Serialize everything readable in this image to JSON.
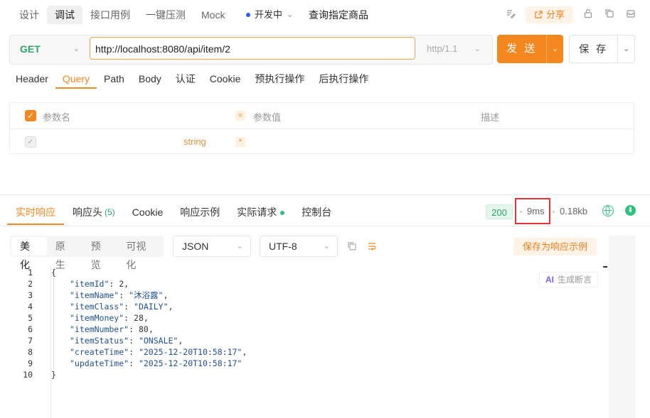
{
  "mode_tabs": [
    "设计",
    "调试",
    "接口用例",
    "一键压测",
    "Mock"
  ],
  "environment": "开发中",
  "api_title": "查询指定商品",
  "share_label": "分享",
  "request": {
    "method": "GET",
    "url": "http://localhost:8080/api/item/2",
    "http_version": "http/1.1",
    "send_label": "发 送",
    "save_label": "保 存"
  },
  "request_tabs": [
    "Header",
    "Query",
    "Path",
    "Body",
    "认证",
    "Cookie",
    "预执行操作",
    "后执行操作"
  ],
  "params": {
    "col_name": "参数名",
    "col_value": "参数值",
    "col_desc": "描述",
    "row_type": "string",
    "row_required": "*"
  },
  "response_tabs": {
    "realtime": "实时响应",
    "headers": "响应头",
    "headers_count": "(5)",
    "cookie": "Cookie",
    "example": "响应示例",
    "actual": "实际请求",
    "console": "控制台"
  },
  "status_code": "200",
  "time": "9ms",
  "size": "0.18kb",
  "format_tabs": [
    "美化",
    "原生",
    "预览",
    "可视化"
  ],
  "format_select": "JSON",
  "encoding_select": "UTF-8",
  "save_example_label": "保存为响应示例",
  "ai_badge": {
    "ai": "AI",
    "label": "生成断言"
  },
  "line_numbers": [
    "1",
    "2",
    "3",
    "4",
    "5",
    "6",
    "7",
    "8",
    "9",
    "10"
  ],
  "response_json": {
    "open": "{",
    "close": "}",
    "fields": [
      {
        "key": "\"itemId\"",
        "value": "2",
        "type": "num"
      },
      {
        "key": "\"itemName\"",
        "value": "\"沐浴露\"",
        "type": "str"
      },
      {
        "key": "\"itemClass\"",
        "value": "\"DAILY\"",
        "type": "str"
      },
      {
        "key": "\"itemMoney\"",
        "value": "28",
        "type": "num"
      },
      {
        "key": "\"itemNumber\"",
        "value": "80",
        "type": "num"
      },
      {
        "key": "\"itemStatus\"",
        "value": "\"ONSALE\"",
        "type": "str"
      },
      {
        "key": "\"createTime\"",
        "value": "\"2025-12-20T10:58:17\"",
        "type": "str"
      },
      {
        "key": "\"updateTime\"",
        "value": "\"2025-12-20T10:58:17\"",
        "type": "str",
        "last": true
      }
    ]
  }
}
